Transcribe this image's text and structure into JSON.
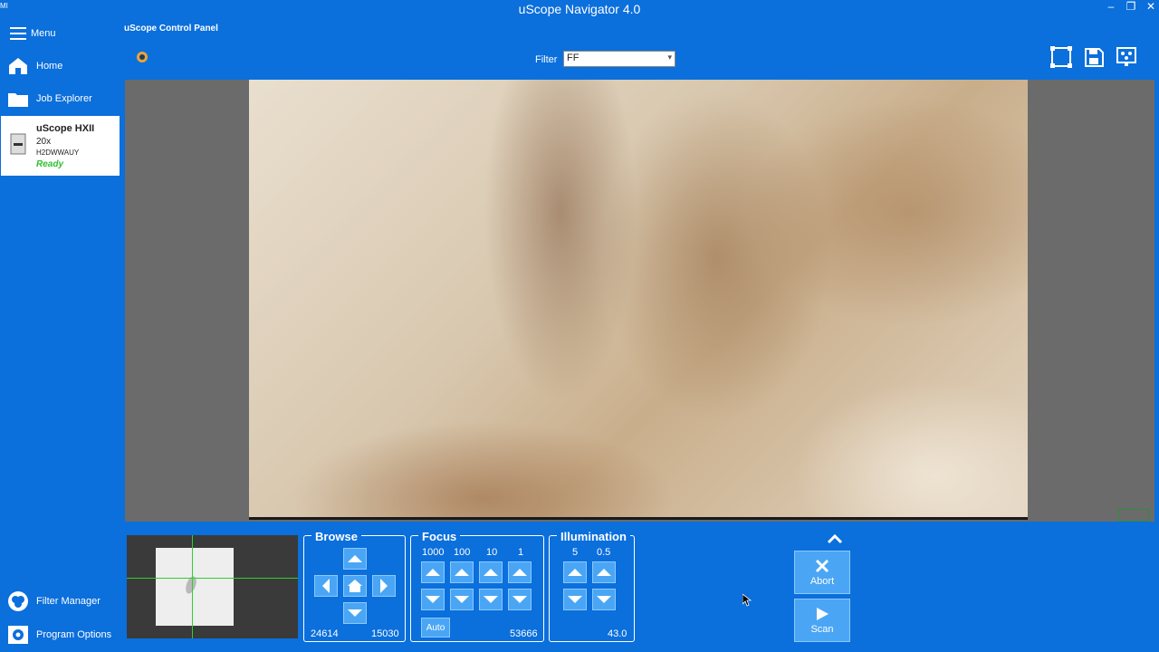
{
  "window": {
    "title": "uScope Navigator 4.0",
    "app_icon_text": "MI"
  },
  "sidebar": {
    "menu_label": "Menu",
    "items": [
      {
        "label": "Home",
        "icon": "home-icon"
      },
      {
        "label": "Job Explorer",
        "icon": "folder-icon"
      }
    ],
    "device": {
      "name": "uScope HXII",
      "magnification": "20x",
      "id": "H2DWWAUY",
      "status": "Ready"
    },
    "bottom_items": [
      {
        "label": "Filter Manager",
        "icon": "filter-icon"
      },
      {
        "label": "Program Options",
        "icon": "gear-icon"
      }
    ]
  },
  "panel": {
    "title": "uScope Control Panel",
    "filter_label": "Filter",
    "filter_value": "FF"
  },
  "browse": {
    "title": "Browse",
    "x": "24614",
    "y": "15030"
  },
  "focus": {
    "title": "Focus",
    "steps": [
      "1000",
      "100",
      "10",
      "1"
    ],
    "auto_label": "Auto",
    "value": "53666"
  },
  "illumination": {
    "title": "Illumination",
    "steps": [
      "5",
      "0.5"
    ],
    "value": "43.0"
  },
  "actions": {
    "abort_label": "Abort",
    "scan_label": "Scan"
  },
  "colors": {
    "accent": "#0b6fdc",
    "button": "#4aa6f5",
    "status_ready": "#2fbf2f"
  }
}
